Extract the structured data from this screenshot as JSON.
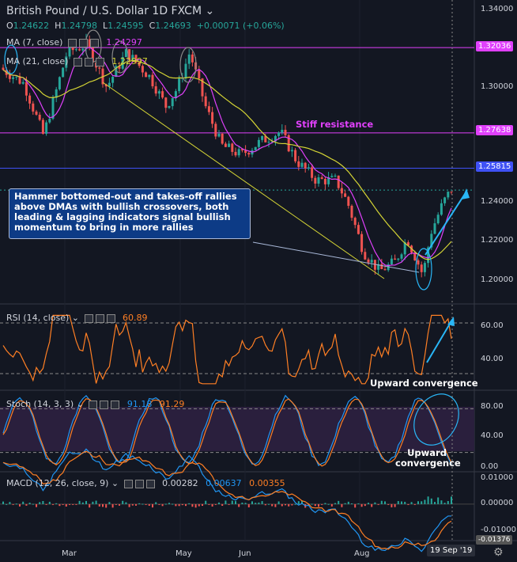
{
  "header": {
    "title": "British Pound / U.S. Dollar",
    "interval": "1D",
    "source": "FXCM",
    "open_label": "O",
    "open": "1.24622",
    "high_label": "H",
    "high": "1.24798",
    "low_label": "L",
    "low": "1.24595",
    "close_label": "C",
    "close": "1.24693",
    "change": "+0.00071 (+0.06%)"
  },
  "indicators": {
    "ma7_label": "MA (7, close)",
    "ma7_value": "1.24297",
    "ma21_label": "MA (21, close)",
    "ma21_value": "1.22997",
    "rsi_label": "RSI (14, close)",
    "rsi_value": "60.89",
    "stoch_label": "Stoch (14, 3, 3)",
    "stoch_k": "91.18",
    "stoch_d": "91.29",
    "macd_label": "MACD (12, 26, close, 9)",
    "macd_v1": "0.00282",
    "macd_v2": "0.00637",
    "macd_v3": "0.00355"
  },
  "annotations": {
    "callout": "Hammer bottomed-out and takes-off rallies above DMAs with bullish crossovers, both leading & lagging indicators signal bullish momentum to bring in more rallies",
    "stiff_resistance": "Stiff resistance",
    "rsi_note": "Upward convergence",
    "stoch_note": "Upward convergence"
  },
  "price_axis": {
    "ticks": [
      "1.34000",
      "1.32036",
      "1.30000",
      "1.27638",
      "1.25815",
      "1.24000",
      "1.22000",
      "1.20000"
    ],
    "tag_1": "1.32036",
    "tag_2": "1.27638",
    "tag_3": "1.25815"
  },
  "rsi_axis": [
    "60.00",
    "40.00"
  ],
  "stoch_axis": [
    "80.00",
    "40.00",
    "0.00"
  ],
  "macd_axis": [
    "0.01000",
    "0.00000",
    "-0.01000",
    "-0.01376"
  ],
  "time_axis": [
    "Mar",
    "May",
    "Jun",
    "Aug"
  ],
  "crosshair_date": "19 Sep '19",
  "colors": {
    "up": "#26a69a",
    "down": "#ef5350",
    "ma7": "#e040fb",
    "ma21": "#d4d435",
    "resistance": "#e040fb",
    "support": "#3f51f5",
    "rsi": "#ff7f24",
    "stoch_k": "#2196f3",
    "stoch_d": "#ff7f24",
    "annotation": "#29b6f6"
  },
  "chart_data": {
    "type": "candlestick",
    "title": "British Pound / U.S. Dollar",
    "interval": "1D",
    "ylim": [
      1.19,
      1.345
    ],
    "horizontal_levels": [
      1.32036,
      1.27638,
      1.25815
    ],
    "key_points": [
      {
        "label": "Mar",
        "close": 1.305
      },
      {
        "label": "May",
        "close": 1.3
      },
      {
        "label": "Jun",
        "close": 1.27
      },
      {
        "label": "Aug",
        "close": 1.21
      },
      {
        "label": "19 Sep '19",
        "close": 1.24693
      }
    ],
    "rsi_last": 60.89,
    "stoch_last": [
      91.18,
      91.29
    ],
    "macd_last": [
      0.00282,
      0.00637,
      0.00355
    ]
  }
}
